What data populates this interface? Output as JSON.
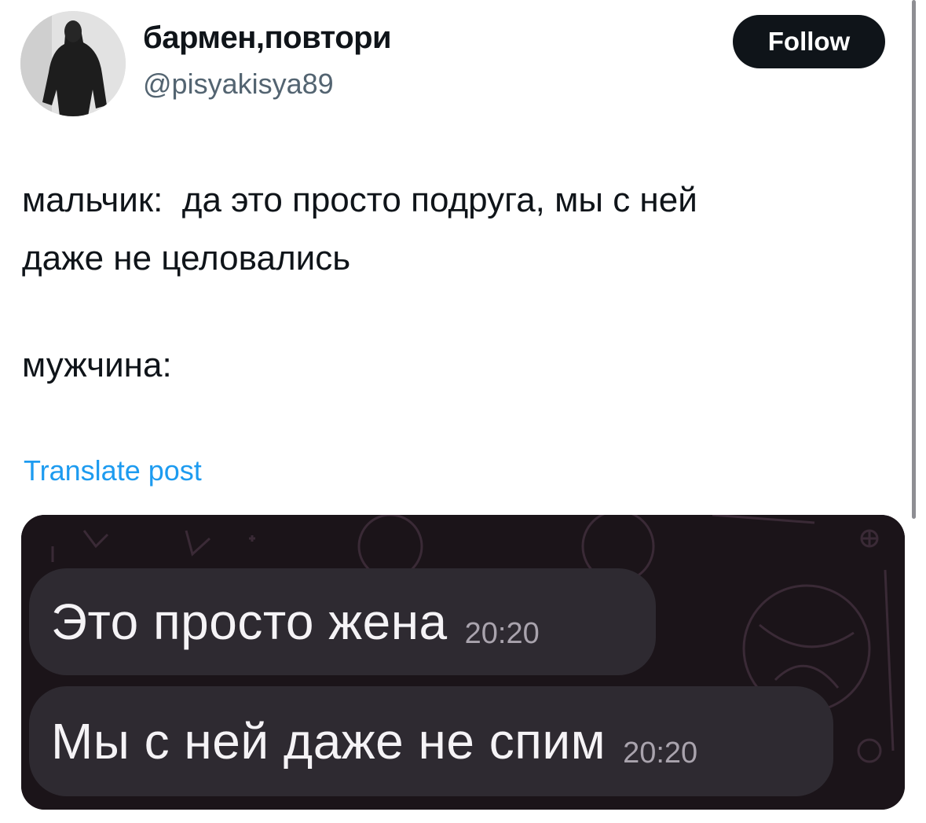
{
  "author": {
    "display_name": "бармен,повтори",
    "handle": "@pisyakisya89"
  },
  "follow_button": {
    "label": "Follow"
  },
  "post": {
    "lines": [
      "мальчик:  да это просто подруга, мы с ней",
      "даже не целовались",
      "мужчина:"
    ],
    "translate_label": "Translate post"
  },
  "media": {
    "messages": [
      {
        "text": "Это просто жена",
        "time": "20:20"
      },
      {
        "text": "Мы с ней даже не спим",
        "time": "20:20"
      }
    ]
  },
  "colors": {
    "follow_bg": "#0f1419",
    "link": "#1d9bf0",
    "chat_bg": "#1b1419",
    "bubble": "#2e2a31"
  }
}
